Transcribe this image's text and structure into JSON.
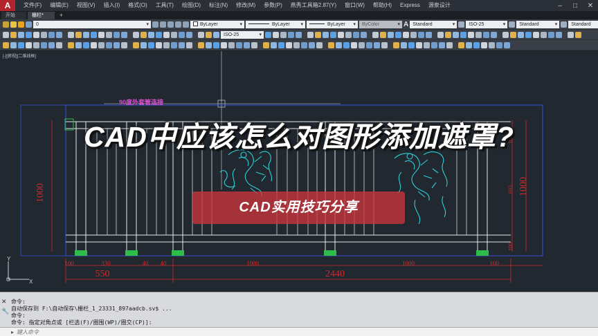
{
  "app": {
    "logo": "A"
  },
  "menu": {
    "items": [
      "文件(F)",
      "编辑(E)",
      "视图(V)",
      "插入(I)",
      "格式(O)",
      "工具(T)",
      "绘图(D)",
      "标注(N)",
      "修改(M)",
      "参数(P)",
      "燕秀工具箱2.87(Y)",
      "窗口(W)",
      "帮助(H)",
      "Express",
      "源泉设计"
    ]
  },
  "window_controls": {
    "minimize": "–",
    "maximize": "□",
    "close": "✕"
  },
  "tabs": [
    {
      "label": "开始"
    },
    {
      "label": "栅栏*"
    }
  ],
  "tab_plus": "+",
  "toolbar": {
    "layer_value": "0",
    "color_value": "ByLayer",
    "linetype_value": "ByLayer",
    "lineweight_value": "ByLayer",
    "plotstyle_value": "ByColor",
    "text_style": "Standard",
    "dim_style": "ISO-25",
    "table_style": "Standard",
    "mleader_style": "Standard",
    "dim_style_2": "ISO-25"
  },
  "viewport": {
    "label": "[-][俯视][二维线框]"
  },
  "overlay": {
    "title": "CAD中应该怎么对图形添加遮罩?",
    "subtitle": "CAD实用技巧分享"
  },
  "annotation": {
    "text": "90度外套管连接"
  },
  "dimensions": {
    "height_left": "1000",
    "height_right": "1000",
    "bottom_small": [
      "100",
      "330",
      "40",
      "40",
      "1000",
      "1000",
      "100"
    ],
    "bottom_total_left": "550",
    "bottom_total_mid": "2440",
    "right_vertical": [
      "100",
      "693",
      "100"
    ]
  },
  "ucs": {
    "x_label": "X",
    "y_label": "Y"
  },
  "command": {
    "lines": [
      "命令:",
      "自动保存到 F:\\自动保存\\栅栏_1_23331_897aadcb.sv$ ...",
      "命令:",
      "命令: 指定对角点或 [栏选(F)/圈围(WP)/圈交(CP)]:"
    ],
    "input_placeholder": "键入命令",
    "close_icon": "✕",
    "wrench_icon": "🔧"
  }
}
